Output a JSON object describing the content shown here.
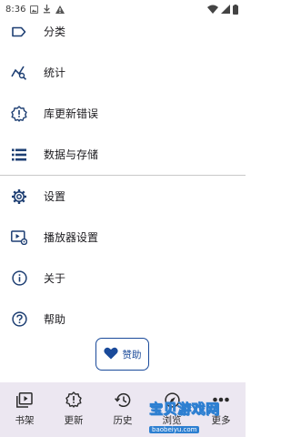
{
  "status_bar": {
    "time": "8:36"
  },
  "menu": {
    "items": [
      {
        "label": "分类",
        "icon": "label-tag-icon"
      },
      {
        "label": "统计",
        "icon": "stats-chart-icon"
      },
      {
        "label": "库更新错误",
        "icon": "alert-badge-icon"
      },
      {
        "label": "数据与存储",
        "icon": "storage-list-icon"
      }
    ],
    "items2": [
      {
        "label": "设置",
        "icon": "gear-icon"
      },
      {
        "label": "播放器设置",
        "icon": "player-settings-icon"
      },
      {
        "label": "关于",
        "icon": "info-icon"
      },
      {
        "label": "帮助",
        "icon": "help-icon"
      }
    ]
  },
  "donate": {
    "label": "赞助",
    "icon": "heart-icon"
  },
  "bottom_nav": {
    "items": [
      {
        "label": "书架",
        "icon": "library-icon"
      },
      {
        "label": "更新",
        "icon": "updates-icon"
      },
      {
        "label": "历史",
        "icon": "history-icon"
      },
      {
        "label": "浏览",
        "icon": "compass-icon"
      },
      {
        "label": "更多",
        "icon": "more-dots-icon"
      }
    ]
  },
  "watermark": {
    "text": "宝贝游戏网",
    "url": "baobeiyu.com"
  },
  "colors": {
    "accent": "#1a4a9a",
    "icon_dark": "#1e3f73",
    "nav_background": "#ece7f1",
    "divider": "#c9c9c9"
  }
}
